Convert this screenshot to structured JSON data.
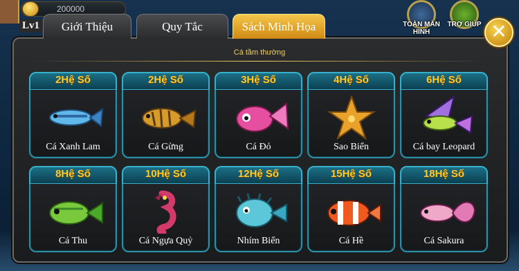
{
  "hud": {
    "level": "Lv1",
    "coins": "200000",
    "button_full_screen": "TOÀN MÀN HÌNH",
    "button_help": "TRỢ GIÚP"
  },
  "tabs": [
    {
      "label": "Giới Thiệu",
      "active": false
    },
    {
      "label": "Quy Tắc",
      "active": false
    },
    {
      "label": "Sách Minh Họa",
      "active": true
    }
  ],
  "section_title": "Cá tầm thường",
  "fish": [
    {
      "multiplier": "2Hệ Số",
      "name": "Cá Xanh Lam",
      "color": "#5fb8e8"
    },
    {
      "multiplier": "2Hệ Số",
      "name": "Cá Gừng",
      "color": "#d69b2a"
    },
    {
      "multiplier": "3Hệ Số",
      "name": "Cá Đỏ",
      "color": "#e64fa0"
    },
    {
      "multiplier": "4Hệ Số",
      "name": "Sao Biển",
      "color": "#e8a12a"
    },
    {
      "multiplier": "6Hệ Số",
      "name": "Cá bay Leopard",
      "color": "#a070e0"
    },
    {
      "multiplier": "8Hệ Số",
      "name": "Cá Thu",
      "color": "#7ac83c"
    },
    {
      "multiplier": "10Hệ Số",
      "name": "Cá Ngựa Quỷ",
      "color": "#d23a6a"
    },
    {
      "multiplier": "12Hệ Số",
      "name": "Nhím Biển",
      "color": "#5cc7d8"
    },
    {
      "multiplier": "15Hệ Số",
      "name": "Cá Hề",
      "color": "#f05a1e"
    },
    {
      "multiplier": "18Hệ Số",
      "name": "Cá Sakura",
      "color": "#e27ab6"
    }
  ]
}
